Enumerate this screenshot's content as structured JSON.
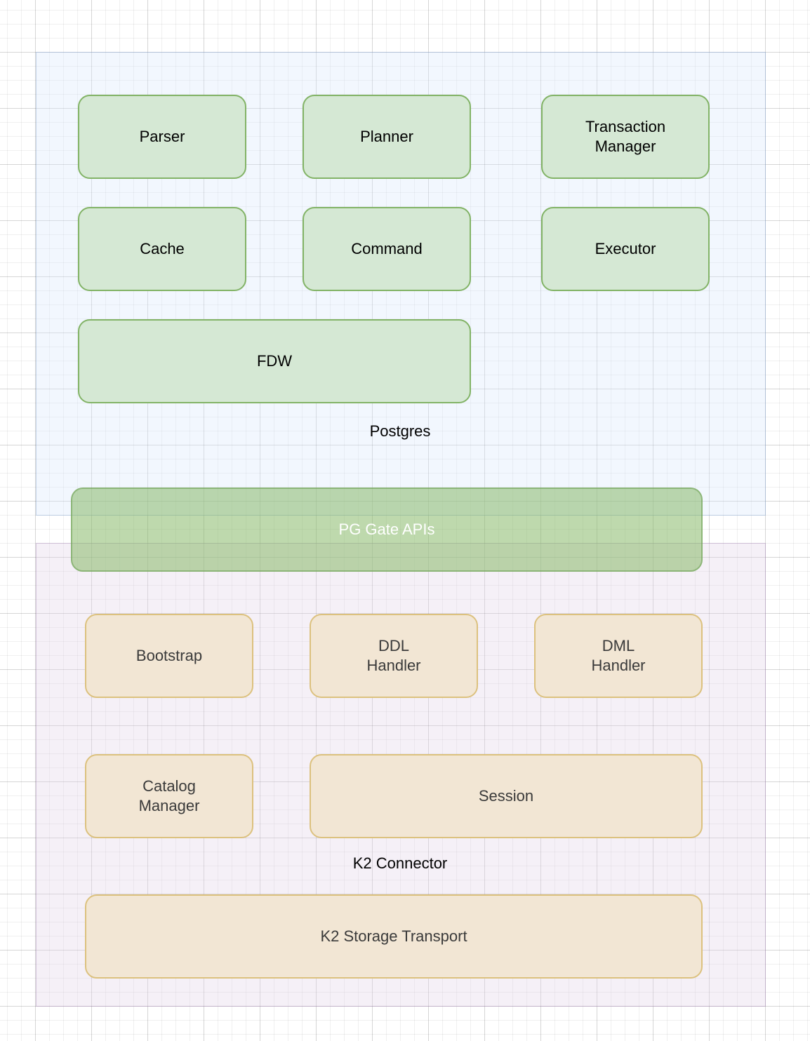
{
  "postgres": {
    "label": "Postgres",
    "components": [
      "Parser",
      "Planner",
      "Transaction\nManager",
      "Cache",
      "Command",
      "Executor",
      "FDW"
    ]
  },
  "gate": {
    "label": "PG Gate APIs"
  },
  "k2": {
    "label": "K2 Connector",
    "components": [
      "Bootstrap",
      "DDL\nHandler",
      "DML\nHandler",
      "Catalog\nManager",
      "Session",
      "K2 Storage Transport"
    ]
  },
  "colors": {
    "pg_fill": "#d5e8d4",
    "pg_stroke": "#82b366",
    "k2_fill": "#f2e6d4",
    "k2_stroke": "#dcc17e",
    "gate_fill": "#89ba6a"
  }
}
